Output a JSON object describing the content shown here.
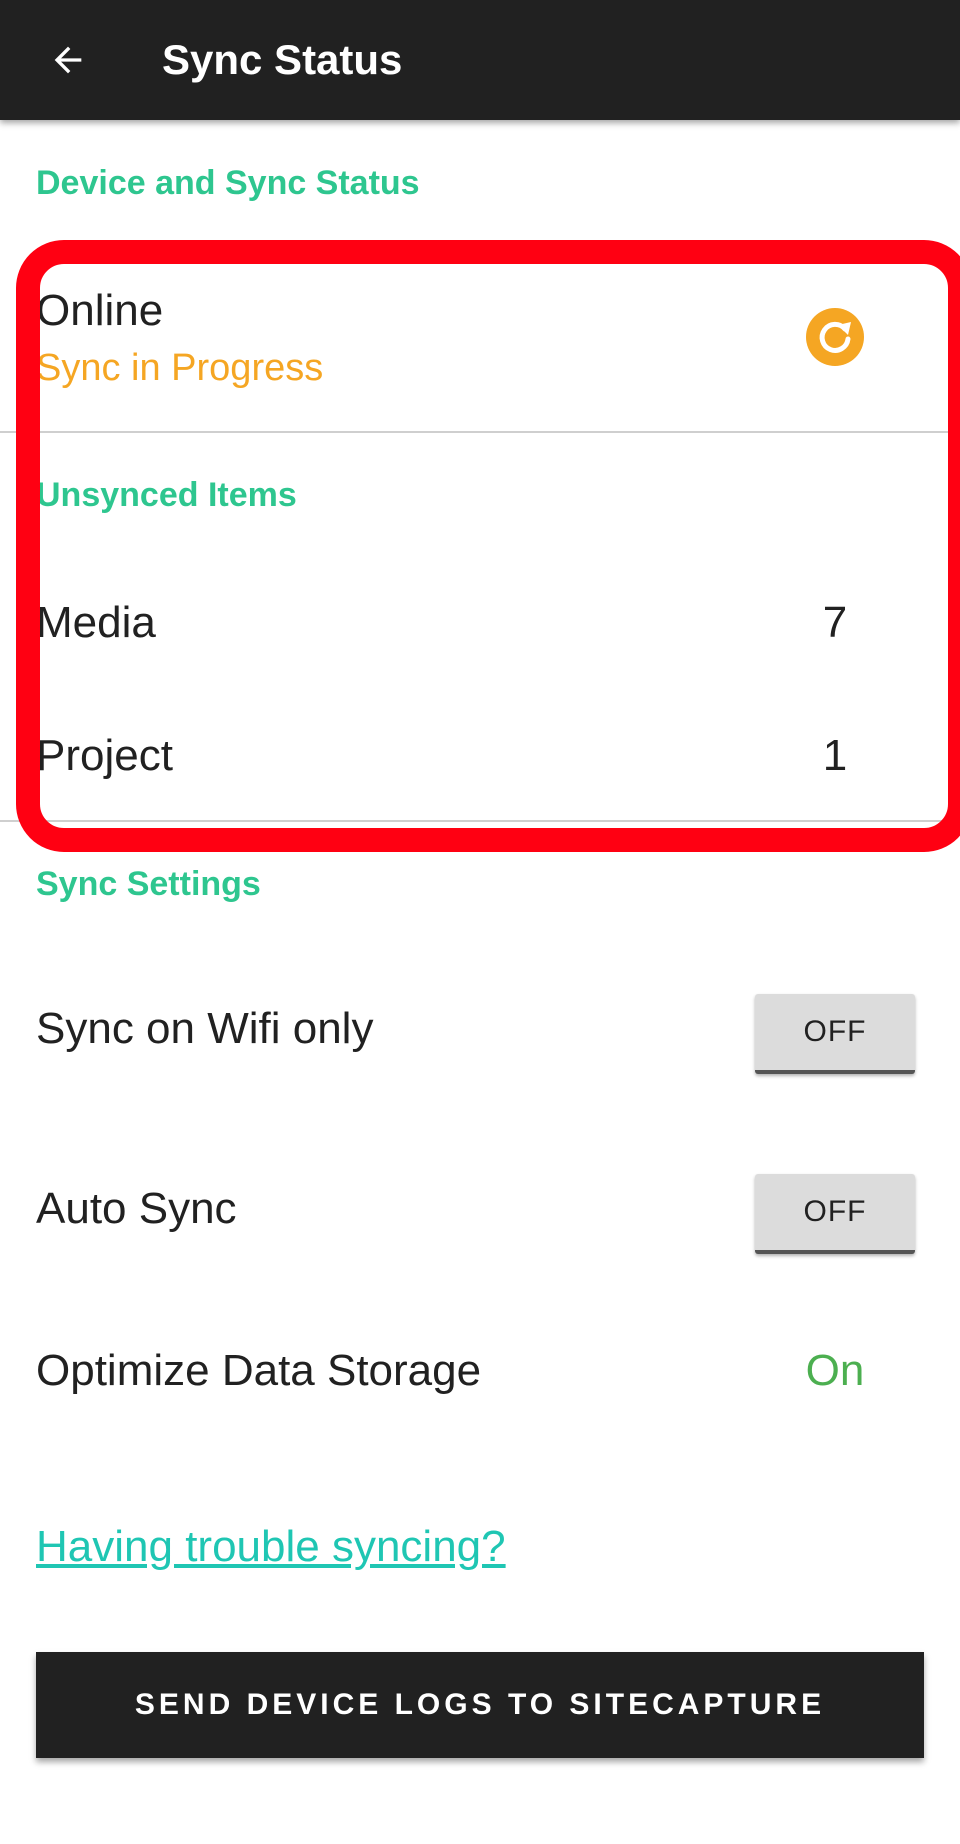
{
  "header": {
    "title": "Sync Status",
    "back_icon": "arrow-back-icon"
  },
  "device_section": {
    "header": "Device and Sync Status",
    "connection_status": "Online",
    "sync_status": "Sync in Progress",
    "sync_icon": "refresh-icon",
    "sync_status_color": "#f5a623"
  },
  "unsynced": {
    "header": "Unsynced Items",
    "items": [
      {
        "label": "Media",
        "count": "7"
      },
      {
        "label": "Project",
        "count": "1"
      }
    ]
  },
  "settings": {
    "header": "Sync Settings",
    "wifi_only": {
      "label": "Sync on Wifi only",
      "value": "OFF"
    },
    "auto_sync": {
      "label": "Auto Sync",
      "value": "OFF"
    },
    "optimize_storage": {
      "label": "Optimize Data Storage",
      "value": "On"
    }
  },
  "trouble_link": "Having trouble syncing?",
  "send_logs_button": "SEND DEVICE LOGS TO SITECAPTURE",
  "colors": {
    "accent_green": "#2ec68f",
    "link_teal": "#1fc6b3",
    "highlight_red": "#ff0012",
    "appbar": "#212121"
  }
}
